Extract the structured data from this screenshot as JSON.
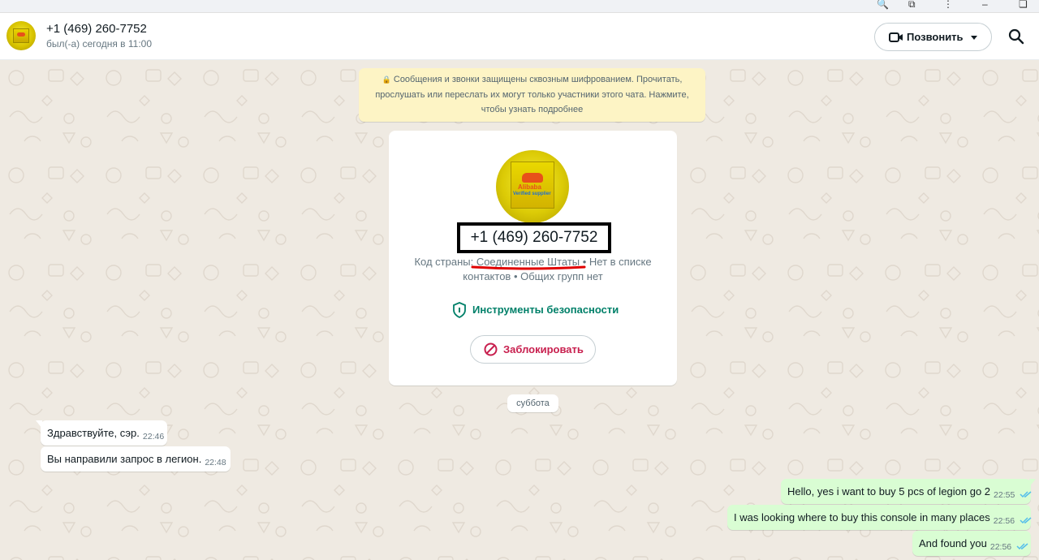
{
  "header": {
    "contact_name": "+1 (469) 260-7752",
    "status": "был(-а) сегодня в 11:00",
    "call_label": "Позвонить"
  },
  "encryption_notice": "Сообщения и звонки защищены сквозным шифрованием. Прочитать, прослушать или переслать их могут только участники этого чата. Нажмите, чтобы узнать подробнее",
  "contact_card": {
    "avatar_text_1": "Alibaba",
    "avatar_text_2": "Verified supplier",
    "phone": "+1 (469) 260-7752",
    "country_prefix": "Код страны: ",
    "country": "Соединенные Штаты",
    "details_rest": " • Нет в списке контактов • Общих групп нет",
    "safety_tools": "Инструменты безопасности",
    "block_label": "Заблокировать"
  },
  "date_divider": "суббота",
  "messages": [
    {
      "dir": "in",
      "text": "Здравствуйте, сэр.",
      "time": "22:46"
    },
    {
      "dir": "in",
      "text": "Вы направили запрос в легион.",
      "time": "22:48"
    },
    {
      "dir": "out",
      "text": "Hello, yes i want to buy 5 pcs of legion go 2",
      "time": "22:55"
    },
    {
      "dir": "out",
      "text": "I was looking where to buy this console in many places",
      "time": "22:56"
    },
    {
      "dir": "out",
      "text": "And found you",
      "time": "22:56"
    }
  ],
  "colors": {
    "accent_green": "#008069",
    "danger_red": "#c81f4e",
    "outgoing_bubble": "#d9fdd3",
    "notice_bg": "#fdf4c5",
    "read_ticks": "#53bdeb",
    "annotation_red": "#e00000"
  }
}
